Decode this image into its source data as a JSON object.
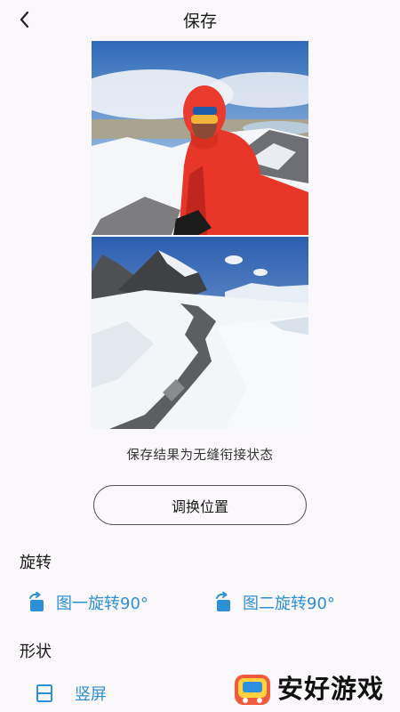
{
  "header": {
    "title": "保存",
    "back_icon": "chevron-left-icon"
  },
  "preview": {
    "image1_subject": "climber-selfie-red-jacket",
    "image2_subject": "snowy-mountain-ridge",
    "caption": "保存结果为无缝衔接状态"
  },
  "actions": {
    "swap_label": "调换位置"
  },
  "rotate": {
    "title": "旋转",
    "options": [
      {
        "label": "图一旋转90°",
        "icon": "rotate-right-icon"
      },
      {
        "label": "图二旋转90°",
        "icon": "rotate-right-icon"
      }
    ]
  },
  "shape": {
    "title": "形状",
    "options": [
      {
        "label": "竖屏",
        "icon": "vertical-split-icon"
      }
    ]
  },
  "watermark": {
    "text": "安好游戏"
  },
  "colors": {
    "accent": "#2d8fd6",
    "background": "#fbf8fb",
    "text": "#1a1a1a"
  }
}
